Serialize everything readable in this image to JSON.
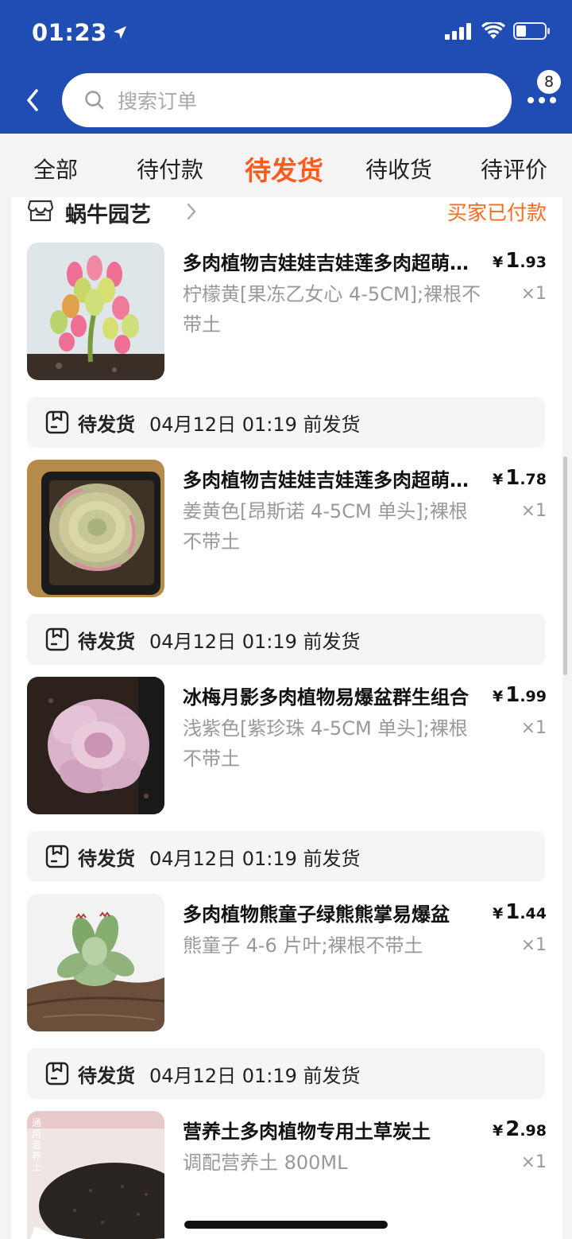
{
  "status_bar": {
    "time": "01:23"
  },
  "header": {
    "search_placeholder": "搜索订单",
    "more_badge": "8"
  },
  "tabs": [
    {
      "label": "全部",
      "active": false
    },
    {
      "label": "待付款",
      "active": false
    },
    {
      "label": "待发货",
      "active": true
    },
    {
      "label": "待收货",
      "active": false
    },
    {
      "label": "待评价",
      "active": false
    }
  ],
  "order": {
    "shop_name": "蜗牛园艺",
    "status": "买家已付款",
    "items": [
      {
        "title": "多肉植物吉娃娃吉娃莲多肉超萌组合",
        "spec": "柠檬黄[果冻乙女心 4-5CM];裸根不带土",
        "price_int": "1",
        "price_dec": ".93",
        "currency": "¥",
        "qty": "×1",
        "image": "pink-succulent-cluster"
      },
      {
        "title": "多肉植物吉娃娃吉娃莲多肉超萌组合",
        "spec": "姜黄色[昂斯诺 4-5CM 单头];裸根不带土",
        "price_int": "1",
        "price_dec": ".78",
        "currency": "¥",
        "qty": "×1",
        "image": "yellow-rosette-succulent"
      },
      {
        "title": "冰梅月影多肉植物易爆盆群生组合",
        "spec": "浅紫色[紫珍珠 4-5CM 单头];裸根不带土",
        "price_int": "1",
        "price_dec": ".99",
        "currency": "¥",
        "qty": "×1",
        "image": "purple-rosette-succulent"
      },
      {
        "title": "多肉植物熊童子绿熊熊掌易爆盆",
        "spec": "熊童子 4-6 片叶;裸根不带土",
        "price_int": "1",
        "price_dec": ".44",
        "currency": "¥",
        "qty": "×1",
        "image": "bear-paw-succulent"
      },
      {
        "title": "营养土多肉植物专用土草炭土",
        "spec": "调配营养土 800ML",
        "price_int": "2",
        "price_dec": ".98",
        "currency": "¥",
        "qty": "×1",
        "image": "potting-soil"
      }
    ],
    "shipping": [
      {
        "status": "待发货",
        "time": "04月12日 01:19 前发货"
      },
      {
        "status": "待发货",
        "time": "04月12日 01:19 前发货"
      },
      {
        "status": "待发货",
        "time": "04月12日 01:19 前发货"
      },
      {
        "status": "待发货",
        "time": "04月12日 01:19 前发货"
      }
    ]
  },
  "soil_package_text": "通用营养土"
}
